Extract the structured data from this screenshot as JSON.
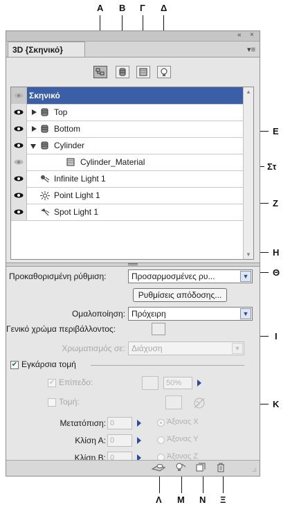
{
  "callouts": {
    "top": [
      "A",
      "B",
      "Γ",
      "Δ"
    ],
    "right": [
      "E",
      "Στ",
      "Z",
      "H",
      "Θ",
      "I",
      "K"
    ],
    "bottom": [
      "Λ",
      "M",
      "N",
      "Ξ"
    ]
  },
  "panel": {
    "collapse_icon": "«",
    "close_icon": "×",
    "tab_title": "3D {Σκηνικό}",
    "menu_icon": "▾≡",
    "filters": [
      {
        "icon": "scene-filter-icon",
        "active": true
      },
      {
        "icon": "mesh-filter-icon",
        "active": false
      },
      {
        "icon": "material-filter-icon",
        "active": false
      },
      {
        "icon": "light-filter-icon",
        "active": false
      }
    ]
  },
  "scene_list": {
    "header": "Σκηνικό",
    "rows": [
      {
        "label": "Top",
        "icon": "mesh-icon",
        "expand": "closed"
      },
      {
        "label": "Bottom",
        "icon": "mesh-icon",
        "expand": "closed"
      },
      {
        "label": "Cylinder",
        "icon": "mesh-icon",
        "expand": "open"
      },
      {
        "label": "Cylinder_Material",
        "icon": "material-icon",
        "expand": "none"
      },
      {
        "label": "Infinite Light 1",
        "icon": "infinite-light-icon",
        "expand": "none"
      },
      {
        "label": "Point Light 1",
        "icon": "point-light-icon",
        "expand": "none"
      },
      {
        "label": "Spot Light 1",
        "icon": "spot-light-icon",
        "expand": "none"
      }
    ]
  },
  "settings": {
    "preset_label": "Προκαθορισμένη ρύθμιση:",
    "preset_value": "Προσαρμοσμένες ρυ...",
    "render_settings_button": "Ρυθμίσεις απόδοσης...",
    "smoothing_label": "Ομαλοποίηση:",
    "smoothing_value": "Πρόχειρη",
    "ambient_label": "Γενικό χρώμα περιβάλλοντος:",
    "paint_on_label": "Χρωματισμός σε:",
    "paint_on_value": "Διάχυση"
  },
  "cross_section": {
    "title": "Εγκάρσια τομή",
    "enabled": true,
    "plane_label": "Επίπεδο:",
    "plane_checked": true,
    "plane_opacity": "50%",
    "intersection_label": "Τομή:",
    "intersection_checked": false,
    "offset_label": "Μετατόπιση:",
    "offset_value": "0",
    "tilt_a_label": "Κλίση Α:",
    "tilt_a_value": "0",
    "tilt_b_label": "Κλίση Β:",
    "tilt_b_value": "0",
    "axis_x": "Άξονας X",
    "axis_y": "Άξονας Y",
    "axis_z": "Άξονας Z",
    "selected_axis": "X"
  },
  "toolbar_icons": [
    "toggle-ground-plane-icon",
    "toggle-lights-icon",
    "new-light-icon",
    "delete-icon"
  ]
}
